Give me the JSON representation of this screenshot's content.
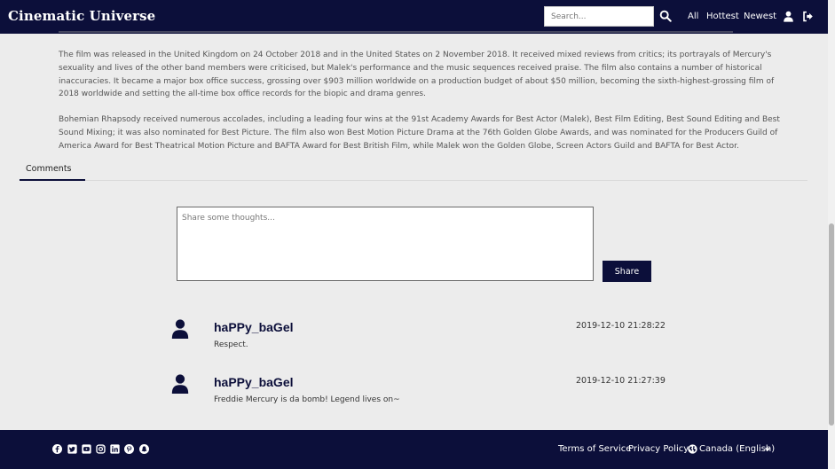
{
  "navbar": {
    "brand": "Cinematic Universe",
    "search_placeholder": "Search...",
    "links": {
      "all": "All",
      "hottest": "Hottest",
      "newest": "Newest"
    }
  },
  "article": {
    "paragraphs": [
      "The film was released in the United Kingdom on 24 October 2018 and in the United States on 2 November 2018. It received mixed reviews from critics; its portrayals of Mercury's sexuality and lives of the other band members were criticised, but Malek's performance and the music sequences received praise. The film also contains a number of historical inaccuracies. It became a major box office success, grossing over $903 million worldwide on a production budget of about $50 million, becoming the sixth-highest-grossing film of 2018 worldwide and setting the all-time box office records for the biopic and drama genres.",
      "Bohemian Rhapsody received numerous accolades, including a leading four wins at the 91st Academy Awards for Best Actor (Malek), Best Film Editing, Best Sound Editing and Best Sound Mixing; it was also nominated for Best Picture. The film also won Best Motion Picture Drama at the 76th Golden Globe Awards, and was nominated for the Producers Guild of America Award for Best Theatrical Motion Picture and BAFTA Award for Best British Film, while Malek won the Golden Globe, Screen Actors Guild and BAFTA for Best Actor."
    ]
  },
  "tabs": {
    "comments": "Comments"
  },
  "comment_form": {
    "placeholder": "Share some thoughts...",
    "share_label": "Share"
  },
  "comments": [
    {
      "user": "haPPy_baGel",
      "time": "2019-12-10 21:28:22",
      "text": "Respect."
    },
    {
      "user": "haPPy_baGel",
      "time": "2019-12-10 21:27:39",
      "text": "Freddie Mercury is da bomb! Legend lives on~"
    }
  ],
  "footer": {
    "social_icons": [
      "facebook-icon",
      "twitter-icon",
      "youtube-icon",
      "instagram-icon",
      "linkedin-icon",
      "pinterest-icon",
      "snapchat-icon"
    ],
    "terms": "Terms of Service",
    "privacy": "Privacy Policy",
    "locale": "Canada (English)"
  },
  "colors": {
    "primary": "#0c0f3a",
    "background": "#ececec"
  }
}
